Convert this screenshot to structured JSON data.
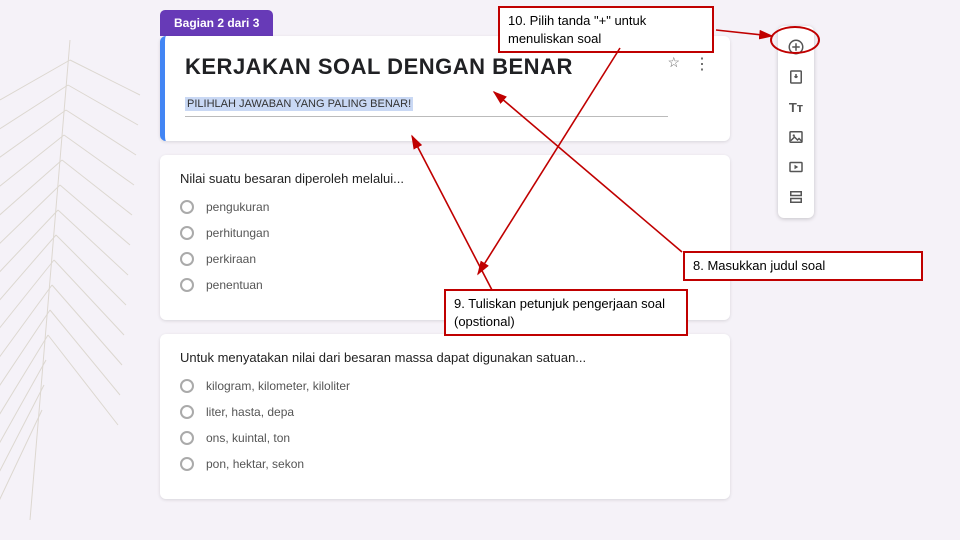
{
  "section_chip": "Bagian 2 dari 3",
  "header": {
    "title": "KERJAKAN SOAL DENGAN BENAR",
    "description": "PILIHLAH JAWABAN YANG PALING BENAR!",
    "star": "☆",
    "more": "⋮"
  },
  "questions": [
    {
      "text": "Nilai suatu besaran diperoleh melalui...",
      "options": [
        "pengukuran",
        "perhitungan",
        "perkiraan",
        "penentuan"
      ]
    },
    {
      "text": "Untuk menyatakan nilai dari besaran massa dapat digunakan satuan...",
      "options": [
        "kilogram, kilometer, kiloliter",
        "liter, hasta, depa",
        "ons, kuintal, ton",
        "pon, hektar, sekon"
      ]
    }
  ],
  "toolbox": {
    "add": "plus-circle-icon",
    "import": "import-icon",
    "text": "Tт",
    "image": "image-icon",
    "video": "video-icon",
    "section": "section-icon"
  },
  "callouts": {
    "c10": "10. Pilih tanda \"+\" untuk menuliskan soal",
    "c8": "8. Masukkan judul soal",
    "c9": "9. Tuliskan petunjuk pengerjaan soal (opstional)"
  }
}
